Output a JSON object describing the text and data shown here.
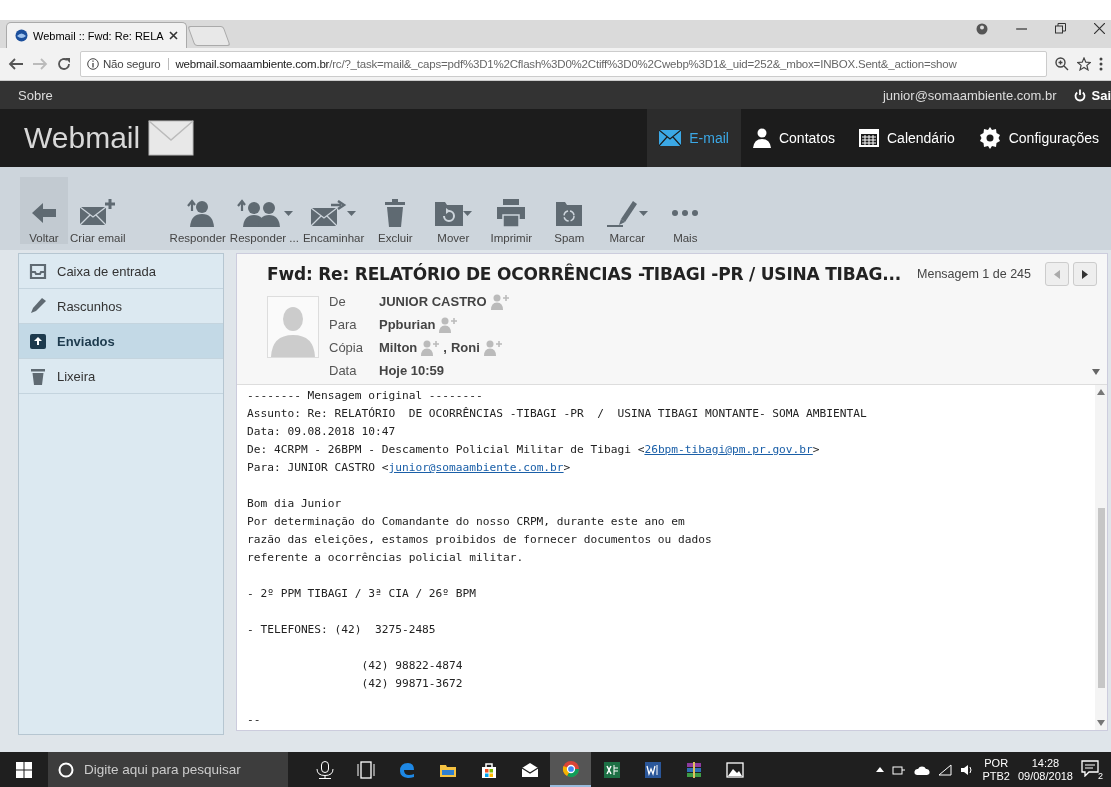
{
  "browser": {
    "tab_title": "Webmail :: Fwd: Re: RELA",
    "security": "Não seguro",
    "url_host": "webmail.somaambiente.com.br",
    "url_path": "/rc/?_task=mail&_caps=pdf%3D1%2Cflash%3D0%2Ctiff%3D0%2Cwebp%3D1&_uid=252&_mbox=INBOX.Sent&_action=show"
  },
  "topbar": {
    "about": "Sobre",
    "user": "junior@somaambiente.com.br",
    "logout": "Sai"
  },
  "header": {
    "logo": "Webmail",
    "nav": [
      {
        "label": "E-mail",
        "kind": "mail",
        "selected": true
      },
      {
        "label": "Contatos",
        "kind": "person",
        "selected": false
      },
      {
        "label": "Calendário",
        "kind": "calendar",
        "selected": false
      },
      {
        "label": "Configurações",
        "kind": "gear",
        "selected": false
      }
    ]
  },
  "toolbar": [
    {
      "label": "Voltar",
      "kind": "back",
      "menu": false
    },
    {
      "label": "Criar email",
      "kind": "compose",
      "menu": false
    },
    {
      "label": "Responder",
      "kind": "reply",
      "menu": false
    },
    {
      "label": "Responder ...",
      "kind": "reply-all",
      "menu": true
    },
    {
      "label": "Encaminhar",
      "kind": "forward",
      "menu": true
    },
    {
      "label": "Excluir",
      "kind": "delete",
      "menu": false
    },
    {
      "label": "Mover",
      "kind": "move",
      "menu": true
    },
    {
      "label": "Imprimir",
      "kind": "print",
      "menu": false
    },
    {
      "label": "Spam",
      "kind": "spam",
      "menu": false
    },
    {
      "label": "Marcar",
      "kind": "mark",
      "menu": true
    },
    {
      "label": "Mais",
      "kind": "more",
      "menu": false
    }
  ],
  "folders": [
    {
      "label": "Caixa de entrada",
      "kind": "inbox",
      "selected": false
    },
    {
      "label": "Rascunhos",
      "kind": "pencil",
      "selected": false
    },
    {
      "label": "Enviados",
      "kind": "sent",
      "selected": true
    },
    {
      "label": "Lixeira",
      "kind": "trash",
      "selected": false
    }
  ],
  "message": {
    "subject": "Fwd: Re: RELATÓRIO DE OCORRÊNCIAS -TIBAGI -PR / USINA TIBAG...",
    "counter": "Mensagem 1 de 245",
    "headers": [
      {
        "label": "De",
        "values": [
          {
            "text": "JUNIOR CASTRO",
            "contact": true
          }
        ]
      },
      {
        "label": "Para",
        "values": [
          {
            "text": "Ppburian",
            "contact": true
          }
        ]
      },
      {
        "label": "Cópia",
        "values": [
          {
            "text": "Milton",
            "contact": true
          },
          {
            "text": ",",
            "contact": false
          },
          {
            "text": "Roni",
            "contact": true
          }
        ]
      },
      {
        "label": "Data",
        "values": [
          {
            "text": "Hoje 10:59",
            "contact": false
          }
        ]
      }
    ],
    "body": [
      [
        {
          "text": "-------- Mensagem original --------"
        },
        {
          "text": "Assunto: Re: RELATÓRIO  DE OCORRÊNCIAS -TIBAGI -PR  /  USINA TIBAGI MONTANTE- SOMA AMBIENTAL"
        },
        {
          "text": "Data: 09.08.2018 10:47"
        },
        {
          "text": "De: 4CRPM - 26BPM - Descamento Policial Militar de Tibagi <",
          "link": "26bpm-tibagi@pm.pr.gov.br",
          "after": ">"
        },
        {
          "text": "Para: JUNIOR CASTRO <",
          "link": "junior@somaambiente.com.br",
          "after": ">"
        }
      ],
      [
        {
          "text": "Bom dia Junior"
        },
        {
          "text": "Por determinação do Comandante do nosso CRPM, durante este ano em"
        },
        {
          "text": "razão das eleições, estamos proibidos de fornecer documentos ou dados"
        },
        {
          "text": "referente a ocorrências policial militar."
        }
      ],
      [
        {
          "text": "- 2º PPM TIBAGI / 3ª CIA / 26º BPM"
        }
      ],
      [
        {
          "text": "- TELEFONES: (42)  3275-2485"
        }
      ],
      [
        {
          "text": "                 (42) 98822-4874"
        },
        {
          "text": "                 (42) 99871-3672"
        }
      ],
      [
        {
          "text": "--"
        }
      ]
    ]
  },
  "taskbar": {
    "search_placeholder": "Digite aqui para pesquisar",
    "apps": [
      {
        "kind": "mic",
        "selected": false
      },
      {
        "kind": "taskview",
        "selected": false
      },
      {
        "kind": "edge",
        "selected": false
      },
      {
        "kind": "files",
        "selected": false
      },
      {
        "kind": "store",
        "selected": false
      },
      {
        "kind": "mail",
        "selected": false
      },
      {
        "kind": "chrome",
        "selected": true
      },
      {
        "kind": "excel",
        "selected": false
      },
      {
        "kind": "word",
        "selected": false
      },
      {
        "kind": "archive",
        "selected": false
      },
      {
        "kind": "photos",
        "selected": false
      }
    ],
    "lang": "POR",
    "layout": "PTB2",
    "time": "14:28",
    "date": "09/08/2018",
    "notifications": "2"
  }
}
